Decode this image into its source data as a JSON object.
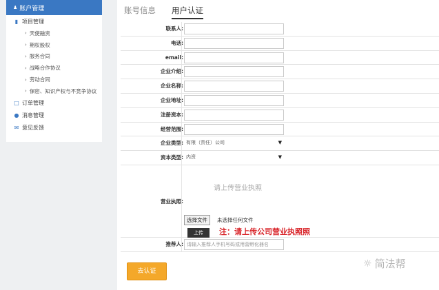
{
  "sidebar": {
    "header": {
      "label": "账户管理"
    },
    "project": {
      "label": "项目管理"
    },
    "sub_items": [
      {
        "label": "天使融资"
      },
      {
        "label": "期权股权"
      },
      {
        "label": "服务合同"
      },
      {
        "label": "战略合作协议"
      },
      {
        "label": "劳动合同"
      },
      {
        "label": "保密、知识产权与不竞争协议"
      }
    ],
    "orders": {
      "label": "订单管理"
    },
    "messages": {
      "label": "消息管理"
    },
    "feedback": {
      "label": "意见反馈"
    }
  },
  "tabs": [
    {
      "label": "账号信息"
    },
    {
      "label": "用户认证"
    }
  ],
  "form": {
    "contact": {
      "label": "联系人:"
    },
    "phone": {
      "label": "电话:"
    },
    "email": {
      "label": "email:"
    },
    "intro": {
      "label": "企业介绍:"
    },
    "name": {
      "label": "企业名称:"
    },
    "address": {
      "label": "企业地址:"
    },
    "capital": {
      "label": "注册资本:"
    },
    "scope": {
      "label": "经营范围:"
    },
    "company_type": {
      "label": "企业类型:",
      "value": "有限（责任）公司"
    },
    "capital_type": {
      "label": "资本类型:",
      "value": "内资"
    },
    "license": {
      "label": "营业执照:",
      "placeholder_text": "请上传营业执照",
      "choose_file": "选择文件",
      "no_file": "未选择任何文件",
      "upload": "上传",
      "note": "注：请上传公司营业执照照"
    },
    "referrer": {
      "label": "推荐人:",
      "placeholder": "请输入推荐人手机号码或用营孵化器名"
    }
  },
  "submit": {
    "label": "去认证"
  },
  "watermark": {
    "label": "简法帮"
  },
  "colors": {
    "accent": "#3a78c3",
    "submit": "#f4a82a",
    "note": "#d9262b"
  }
}
